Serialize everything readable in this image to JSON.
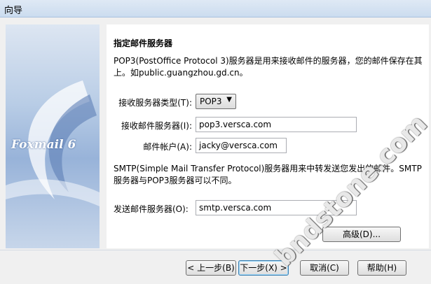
{
  "window": {
    "title": "向导"
  },
  "banner": {
    "brand": "Foxmail 6"
  },
  "form": {
    "heading": "指定邮件服务器",
    "intro": "POP3(PostOffice Protocol 3)服务器是用来接收邮件的服务器，您的邮件保存在其上。如public.guangzhou.gd.cn。",
    "server_type_label": "接收服务器类型(T):",
    "server_type_value": "POP3",
    "incoming_label": "接收邮件服务器(I):",
    "incoming_value": "pop3.versca.com",
    "account_label": "邮件帐户(A):",
    "account_value": "jacky@versca.com",
    "smtp_intro": "SMTP(Simple Mail Transfer Protocol)服务器用来中转发送您发出的邮件。SMTP服务器与POP3服务器可以不同。",
    "outgoing_label": "发送邮件服务器(O):",
    "outgoing_value": "smtp.versca.com",
    "advanced_label": "高级(D)..."
  },
  "buttons": {
    "back": "< 上一步(B)",
    "next": "下一步(X) >",
    "cancel": "取消(C)",
    "help": "帮助(H)"
  },
  "watermark": "bndstone.com"
}
